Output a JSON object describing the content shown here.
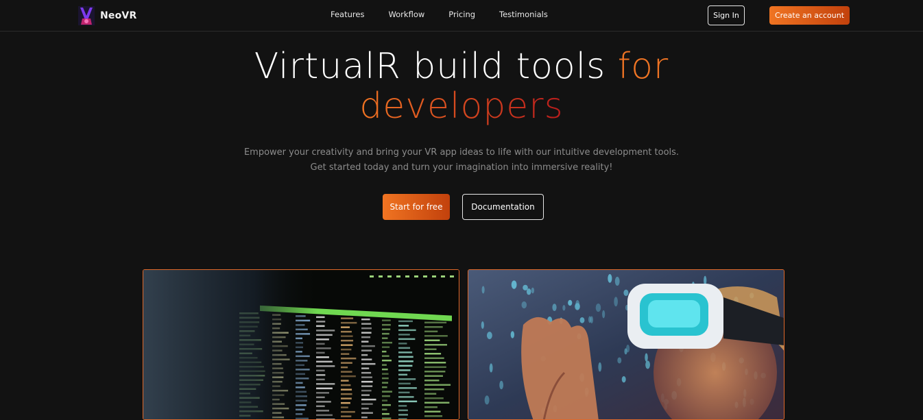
{
  "brand": {
    "name": "NeoVR",
    "logo": "neovr-logo"
  },
  "nav": {
    "links": [
      "Features",
      "Workflow",
      "Pricing",
      "Testimonials"
    ],
    "sign_in": "Sign In",
    "create_account": "Create an account"
  },
  "hero": {
    "title_part1": "VirtualR build tools ",
    "title_accent_1": "for",
    "title_accent_2": "developers",
    "subtitle_line1": "Empower your creativity and bring your VR app ideas to life with our intuitive development tools.",
    "subtitle_line2": "Get started today and turn your imagination into immersive reality!",
    "cta_primary": "Start for free",
    "cta_secondary": "Documentation"
  },
  "images": [
    {
      "name": "code-terminal-image",
      "alt": "code-terminal"
    },
    {
      "name": "vr-headset-image",
      "alt": "vr-headset"
    }
  ],
  "colors": {
    "background": "#121212",
    "accent_start": "#f07422",
    "accent_end": "#b91c1c",
    "muted_text": "#8c8c8c"
  }
}
